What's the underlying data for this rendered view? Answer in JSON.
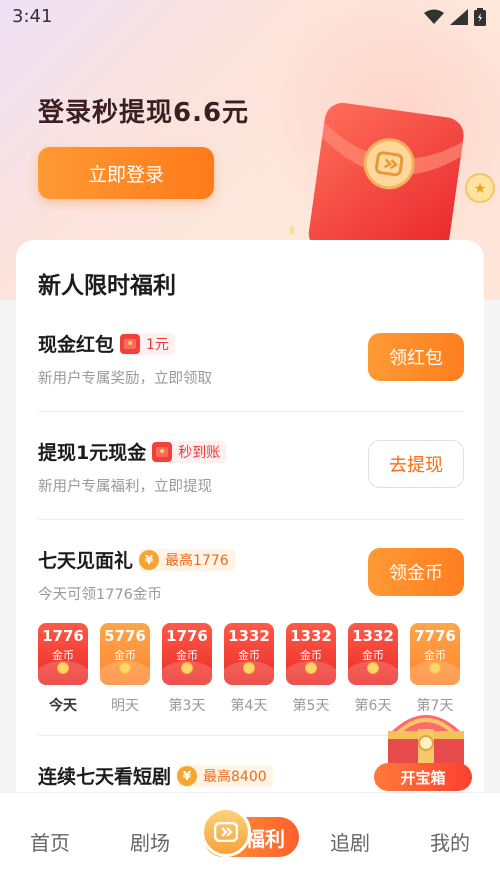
{
  "status": {
    "time": "3:41"
  },
  "hero": {
    "title": "登录秒提现6.6元",
    "login_button": "立即登录"
  },
  "card": {
    "title": "新人限时福利",
    "items": [
      {
        "title": "现金红包",
        "tag": "1元",
        "subtitle": "新用户专属奖励，立即领取",
        "button": "领红包"
      },
      {
        "title": "提现1元现金",
        "tag": "秒到账",
        "subtitle": "新用户专属福利，立即提现",
        "button": "去提现"
      },
      {
        "title": "七天见面礼",
        "tag": "最高1776",
        "subtitle": "今天可领1776金币",
        "button": "领金币"
      },
      {
        "title": "连续七天看短剧",
        "tag": "最高8400"
      }
    ],
    "days": [
      {
        "amount": "1776",
        "unit": "金币",
        "label": "今天",
        "style": "red"
      },
      {
        "amount": "5776",
        "unit": "金币",
        "label": "明天",
        "style": "gold"
      },
      {
        "amount": "1776",
        "unit": "金币",
        "label": "第3天",
        "style": "red"
      },
      {
        "amount": "1332",
        "unit": "金币",
        "label": "第4天",
        "style": "red"
      },
      {
        "amount": "1332",
        "unit": "金币",
        "label": "第5天",
        "style": "red"
      },
      {
        "amount": "1332",
        "unit": "金币",
        "label": "第6天",
        "style": "red"
      },
      {
        "amount": "7776",
        "unit": "金币",
        "label": "第7天",
        "style": "gold"
      }
    ]
  },
  "treasure": {
    "label": "开宝箱"
  },
  "nav": {
    "items": [
      "首页",
      "剧场",
      "福利",
      "追剧",
      "我的"
    ],
    "active": "福利"
  },
  "colors": {
    "accent": "#ff7e1f",
    "red": "#f23a3a",
    "text": "#1c1c1c"
  }
}
